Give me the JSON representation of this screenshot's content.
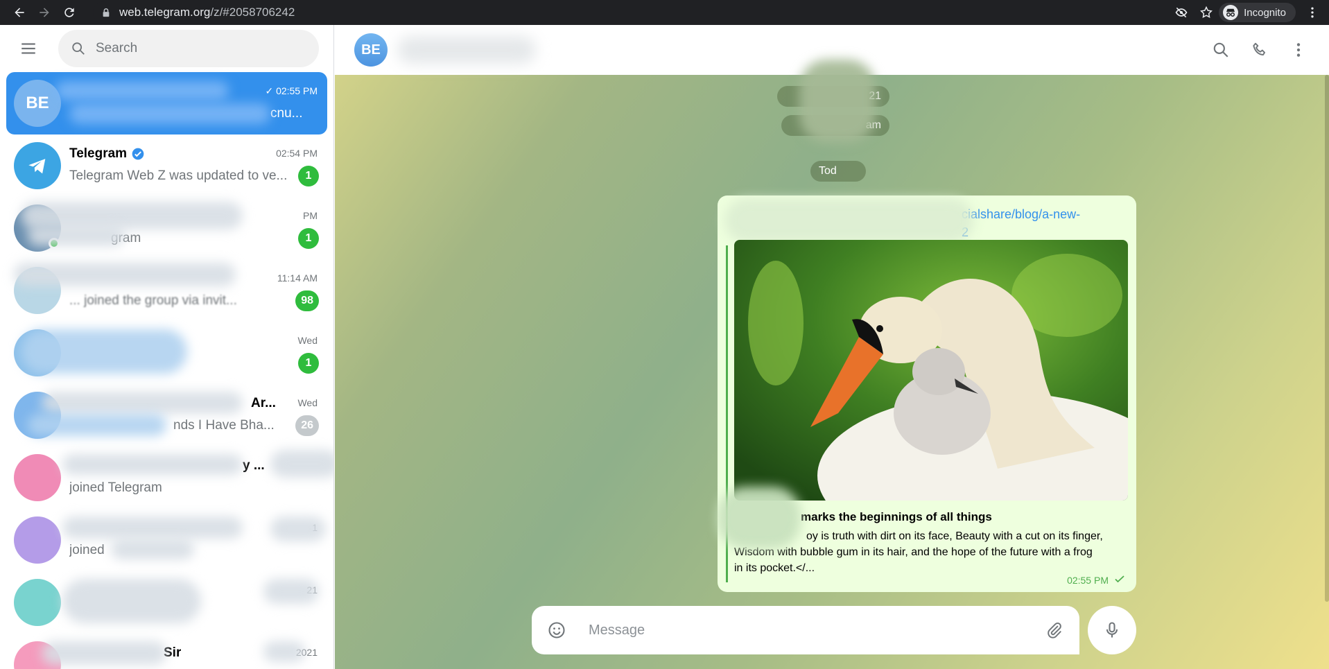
{
  "browser": {
    "url_host": "web.telegram.org",
    "url_path": "/z/#2058706242",
    "incognito_label": "Incognito"
  },
  "search": {
    "placeholder": "Search"
  },
  "chats": [
    {
      "initials": "BE",
      "title": "",
      "time": "02:55 PM",
      "preview": "cnu...",
      "active": true,
      "avatar_color": "#7ab4ee"
    },
    {
      "title": "Telegram",
      "time": "02:54 PM",
      "preview": "Telegram Web Z was updated to ve...",
      "badge": "1",
      "avatar_color": "#3ca5e3",
      "verified": true
    },
    {
      "title": "",
      "time": "PM",
      "preview": "gram",
      "badge": "1",
      "avatar_color": "#6a8fb0"
    },
    {
      "title": "",
      "time": "11:14 AM",
      "preview": "... joined the group via invit...",
      "badge": "98",
      "avatar_color": "#b9d7e6"
    },
    {
      "title": "",
      "time": "Wed",
      "preview": "",
      "badge": "1",
      "avatar_color": "#8cc0ea"
    },
    {
      "title": "Ar...",
      "time": "Wed",
      "preview": "nds I Have Bha...",
      "badge": "26",
      "badge_muted": true,
      "avatar_color": "#7fb6ec"
    },
    {
      "title": "y ...",
      "time": "",
      "preview": "joined Telegram",
      "avatar_color": "#f08bb6"
    },
    {
      "title": "",
      "time": "1",
      "preview": "joined",
      "avatar_color": "#b49ce8"
    },
    {
      "title": "",
      "time": "21",
      "preview": "",
      "avatar_color": "#79d3cf"
    },
    {
      "title": "Sir",
      "time": "2021",
      "preview": "",
      "avatar_color": "#f59bbd"
    }
  ],
  "header": {
    "initials": "BE"
  },
  "service": {
    "date1": "21",
    "joined": "am",
    "today": "Tod"
  },
  "message": {
    "link_line1": "cialshare/blog/a-new-",
    "link_line2": "2",
    "preview_title": "marks the beginnings of all things",
    "preview_desc_line1": "oy is truth with dirt on its face, Beauty with a cut on its finger,",
    "preview_desc_line2": "Wisdom with bubble gum in its hair, and the hope of the future with a frog",
    "preview_desc_line3": "in its pocket.</...",
    "time": "02:55 PM"
  },
  "composer": {
    "placeholder": "Message"
  }
}
